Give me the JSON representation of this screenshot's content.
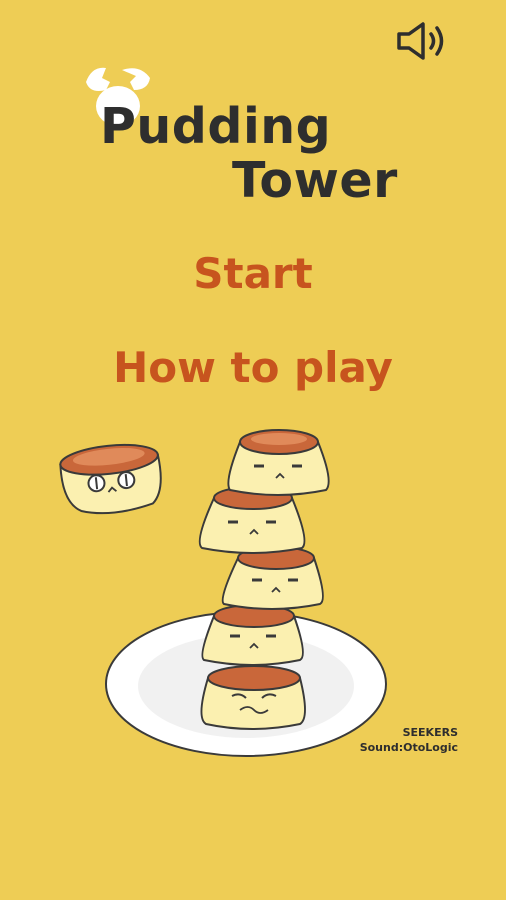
{
  "title": {
    "line1": "Pudding",
    "line2": "Tower"
  },
  "menu": {
    "start": "Start",
    "how_to_play": "How to play"
  },
  "credits": {
    "studio": "SEEKERS",
    "sound": "Sound:OtoLogic"
  },
  "icons": {
    "sound": "speaker-volume-icon",
    "logo": "egg-shell-icon"
  },
  "colors": {
    "background": "#eecd55",
    "title": "#2e2e2e",
    "menu": "#c7541e",
    "pudding": "#fbf0b0",
    "caramel": "#c9673a"
  }
}
